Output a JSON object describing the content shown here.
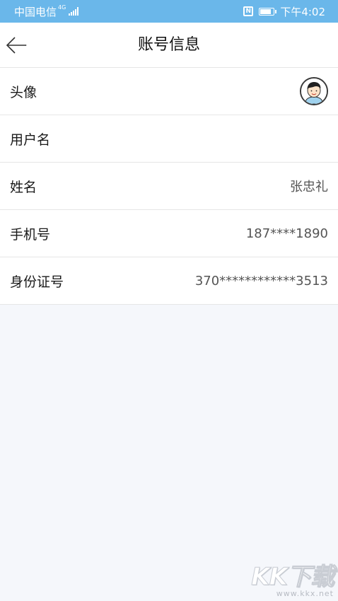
{
  "status_bar": {
    "carrier": "中国电信",
    "network": "4G",
    "time": "下午4:02",
    "nfc": "N",
    "battery_level": 0.85
  },
  "header": {
    "title": "账号信息"
  },
  "rows": [
    {
      "label": "头像",
      "value": ""
    },
    {
      "label": "用户名",
      "value": ""
    },
    {
      "label": "姓名",
      "value": "张忠礼"
    },
    {
      "label": "手机号",
      "value": "187****1890"
    },
    {
      "label": "身份证号",
      "value": "370************3513"
    }
  ],
  "watermark": {
    "logo": "KK下载",
    "url": "www.kkx.net"
  },
  "colors": {
    "status_bar": "#6ab7ea",
    "background": "#f5f7fb"
  }
}
